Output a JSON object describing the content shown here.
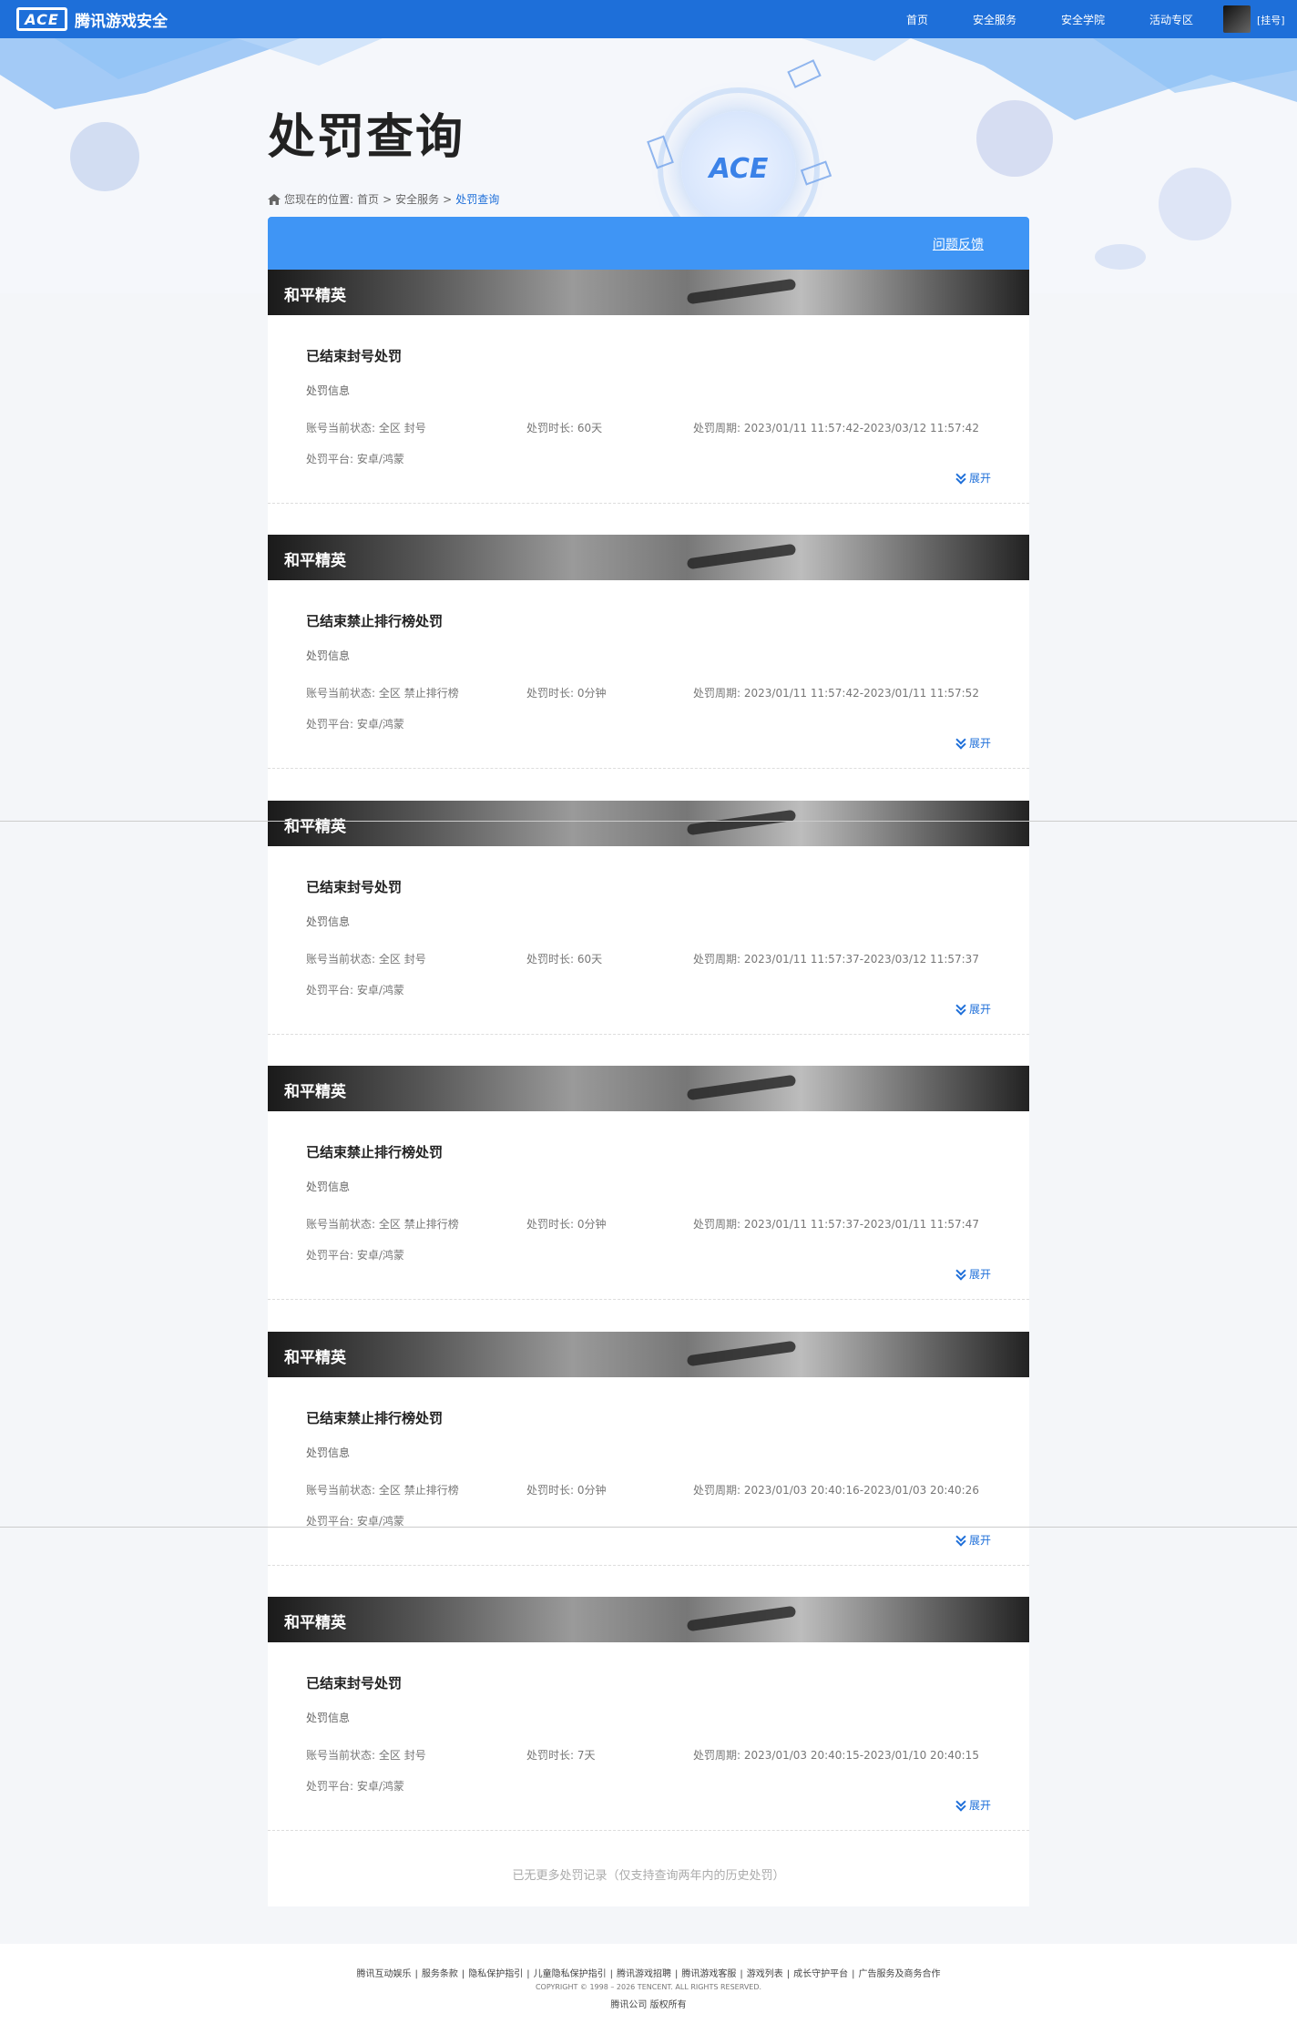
{
  "nav": {
    "brand": "腾讯游戏安全",
    "logo_text": "ACE",
    "items": [
      "首页",
      "安全服务",
      "安全学院",
      "活动专区"
    ],
    "username": "[挂号]"
  },
  "page": {
    "title": "处罚查询",
    "breadcrumb": {
      "prefix": "您现在的位置:",
      "home": "首页",
      "sep1": ">",
      "service": "安全服务",
      "sep2": ">",
      "current": "处罚查询"
    },
    "feedback": "问题反馈",
    "end_note": "已无更多处罚记录（仅支持查询两年内的历史处罚）"
  },
  "cards": [
    {
      "game": "和平精英",
      "title": "已结束封号处罚",
      "subtitle": "处罚信息",
      "status_label": "账号当前状态:",
      "status": "全区 封号",
      "duration_label": "处罚时长:",
      "duration": "60天",
      "period_label": "处罚周期:",
      "period": "2023/01/11 11:57:42-2023/03/12 11:57:42",
      "platform_label": "处罚平台:",
      "platform": "安卓/鸿蒙",
      "expand": "展开"
    },
    {
      "game": "和平精英",
      "title": "已结束禁止排行榜处罚",
      "subtitle": "处罚信息",
      "status_label": "账号当前状态:",
      "status": "全区 禁止排行榜",
      "duration_label": "处罚时长:",
      "duration": "0分钟",
      "period_label": "处罚周期:",
      "period": "2023/01/11 11:57:42-2023/01/11 11:57:52",
      "platform_label": "处罚平台:",
      "platform": "安卓/鸿蒙",
      "expand": "展开"
    },
    {
      "game": "和平精英",
      "title": "已结束封号处罚",
      "subtitle": "处罚信息",
      "status_label": "账号当前状态:",
      "status": "全区 封号",
      "duration_label": "处罚时长:",
      "duration": "60天",
      "period_label": "处罚周期:",
      "period": "2023/01/11 11:57:37-2023/03/12 11:57:37",
      "platform_label": "处罚平台:",
      "platform": "安卓/鸿蒙",
      "expand": "展开"
    },
    {
      "game": "和平精英",
      "title": "已结束禁止排行榜处罚",
      "subtitle": "处罚信息",
      "status_label": "账号当前状态:",
      "status": "全区 禁止排行榜",
      "duration_label": "处罚时长:",
      "duration": "0分钟",
      "period_label": "处罚周期:",
      "period": "2023/01/11 11:57:37-2023/01/11 11:57:47",
      "platform_label": "处罚平台:",
      "platform": "安卓/鸿蒙",
      "expand": "展开"
    },
    {
      "game": "和平精英",
      "title": "已结束禁止排行榜处罚",
      "subtitle": "处罚信息",
      "status_label": "账号当前状态:",
      "status": "全区 禁止排行榜",
      "duration_label": "处罚时长:",
      "duration": "0分钟",
      "period_label": "处罚周期:",
      "period": "2023/01/03 20:40:16-2023/01/03 20:40:26",
      "platform_label": "处罚平台:",
      "platform": "安卓/鸿蒙",
      "expand": "展开"
    },
    {
      "game": "和平精英",
      "title": "已结束封号处罚",
      "subtitle": "处罚信息",
      "status_label": "账号当前状态:",
      "status": "全区 封号",
      "duration_label": "处罚时长:",
      "duration": "7天",
      "period_label": "处罚周期:",
      "period": "2023/01/03 20:40:15-2023/01/10 20:40:15",
      "platform_label": "处罚平台:",
      "platform": "安卓/鸿蒙",
      "expand": "展开"
    }
  ],
  "footer": {
    "links": [
      "腾讯互动娱乐",
      "服务条款",
      "隐私保护指引",
      "儿童隐私保护指引",
      "腾讯游戏招聘",
      "腾讯游戏客服",
      "游戏列表",
      "成长守护平台",
      "广告服务及商务合作"
    ],
    "copyright": "COPYRIGHT © 1998 – 2026 TENCENT. ALL RIGHTS RESERVED.",
    "company": "腾讯公司 版权所有"
  }
}
